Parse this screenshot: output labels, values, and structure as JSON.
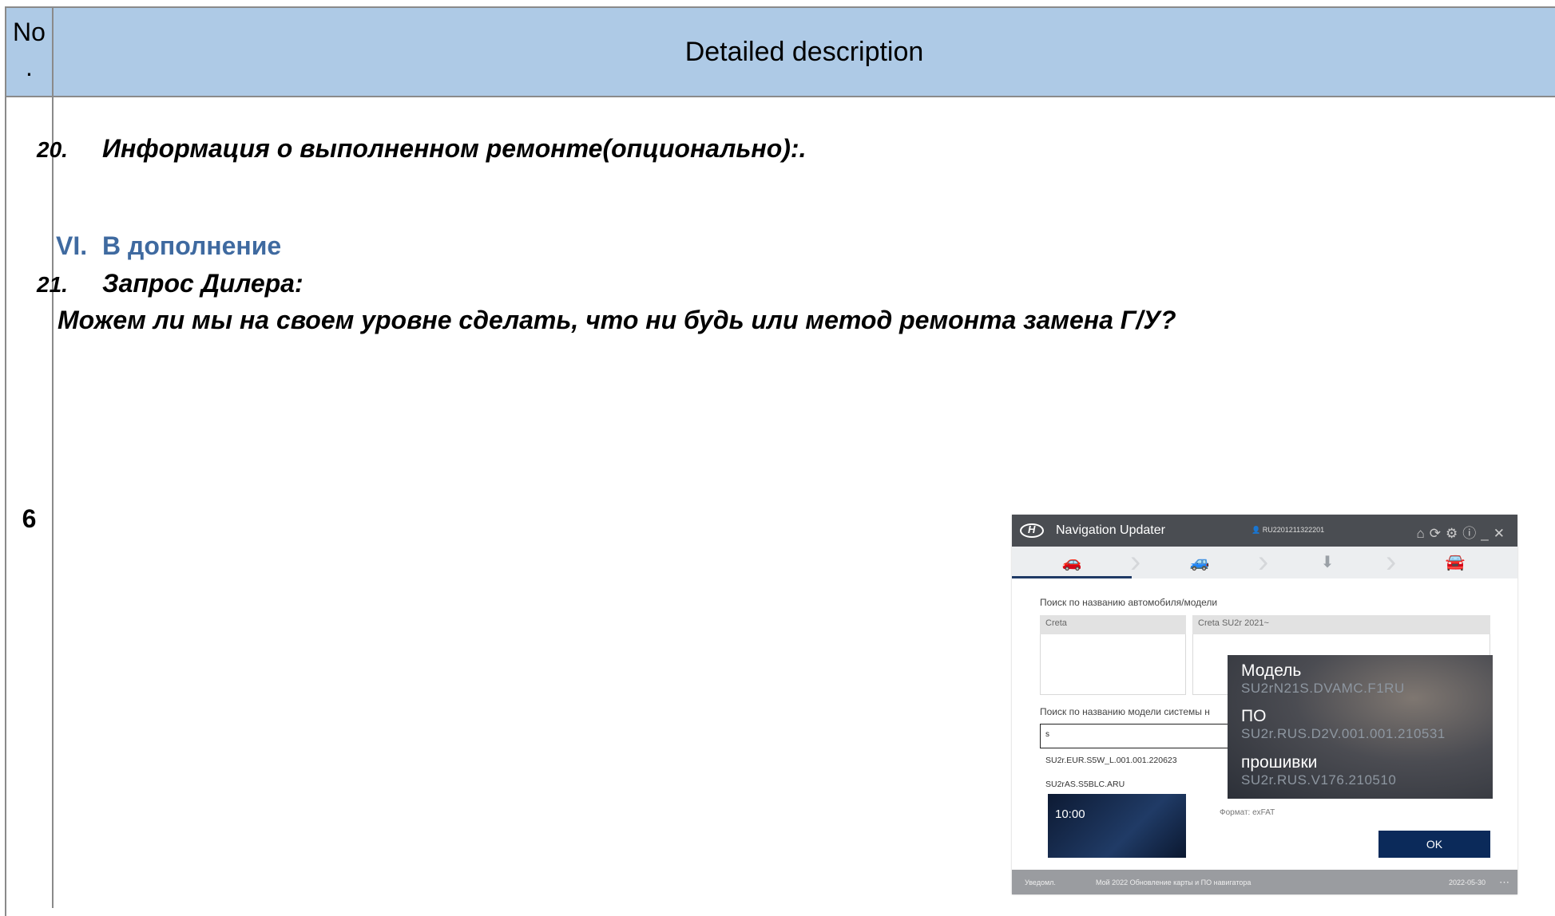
{
  "header": {
    "no_label": "No",
    "no_label_dot": ".",
    "desc_label": "Detailed description"
  },
  "row": {
    "number": "6"
  },
  "items": {
    "i20": {
      "num": "20.",
      "text": "Информация о выполненном ремонте(опционально):."
    },
    "section": {
      "num": "VI.",
      "text": "В дополнение"
    },
    "i21": {
      "num": "21.",
      "text": "Запрос Дилера:"
    },
    "question": "Можем ли мы на своем уровне сделать, что ни будь или метод ремонта замена Г/У?"
  },
  "app": {
    "title": "Navigation Updater",
    "logo_letter": "H",
    "user_id": "RU2201211322201",
    "titlebar_icons": [
      "home-icon",
      "refresh-icon",
      "gear-icon",
      "help-icon",
      "minimize-icon",
      "close-icon"
    ],
    "steps": [
      {
        "icon": "car-search-icon",
        "glyph": "🚗",
        "active": true
      },
      {
        "icon": "car-update-icon",
        "glyph": "🚙",
        "active": false
      },
      {
        "icon": "download-icon",
        "glyph": "⬇",
        "active": false
      },
      {
        "icon": "car-device-icon",
        "glyph": "🚘",
        "active": false
      }
    ],
    "search_car_label": "Поиск по названию автомобиля/модели",
    "car_name": "Creta",
    "car_model": "Creta SU2r 2021~",
    "search_system_label": "Поиск по названию модели системы н",
    "search_value": "s",
    "suggestions": [
      "SU2r.EUR.S5W_L.001.001.220623",
      "SU2rAS.S5BLC.ARU"
    ],
    "thumb_time": "10:00",
    "format_text": "Формат: exFAT",
    "ok_label": "OK",
    "status": {
      "notify": "Уведомл.",
      "message": "Мой 2022 Обновление карты и ПО навигатора",
      "date": "2022-05-30",
      "more": "⋯"
    },
    "overlay": {
      "model_label": "Модель",
      "model_value": "SU2rN21S.DVAMC.F1RU",
      "sw_label": "ПО",
      "sw_value": "SU2r.RUS.D2V.001.001.210531",
      "fw_label": "прошивки",
      "fw_value": "SU2r.RUS.V176.210510"
    }
  }
}
